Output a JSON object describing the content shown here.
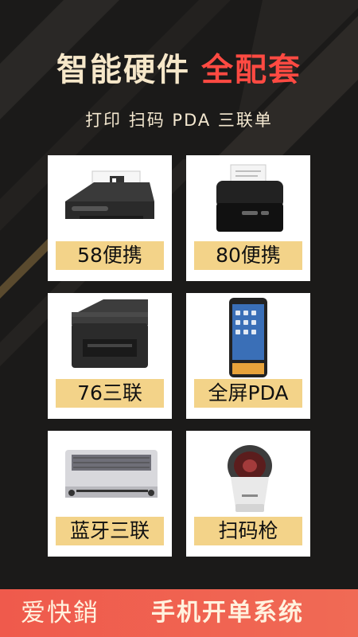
{
  "header": {
    "title_main": "智能硬件",
    "title_accent": "全配套",
    "subtitle": "打印  扫码  PDA  三联单"
  },
  "products": [
    {
      "label": "58便携",
      "icon": "thermal-printer-58-icon"
    },
    {
      "label": "80便携",
      "icon": "thermal-printer-80-icon"
    },
    {
      "label": "76三联",
      "icon": "dot-matrix-printer-76-icon"
    },
    {
      "label": "全屏PDA",
      "icon": "pda-device-icon"
    },
    {
      "label": "蓝牙三联",
      "icon": "bluetooth-dot-matrix-printer-icon"
    },
    {
      "label": "扫码枪",
      "icon": "barcode-scanner-icon"
    }
  ],
  "footer": {
    "brand": "爱快銷",
    "slogan": "手机开单系统"
  },
  "colors": {
    "background": "#1b1a19",
    "title": "#f6e7c9",
    "accent": "#ff4a42",
    "label_bg": "#f3d389",
    "footer_bg": "#ef5a4c"
  }
}
